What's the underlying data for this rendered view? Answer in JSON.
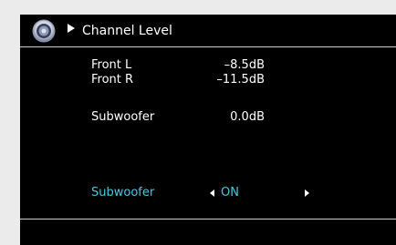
{
  "header": {
    "title": "Channel Level",
    "icon": "speaker-icon"
  },
  "channels": [
    {
      "label": "Front L",
      "value": "–8.5dB"
    },
    {
      "label": "Front R",
      "value": "–11.5dB"
    },
    {
      "label": "Subwoofer",
      "value": "0.0dB"
    }
  ],
  "subwoofer_setting": {
    "label": "Subwoofer",
    "value": "ON"
  },
  "colors": {
    "background": "#000000",
    "text": "#ffffff",
    "highlight": "#48c8dd"
  }
}
